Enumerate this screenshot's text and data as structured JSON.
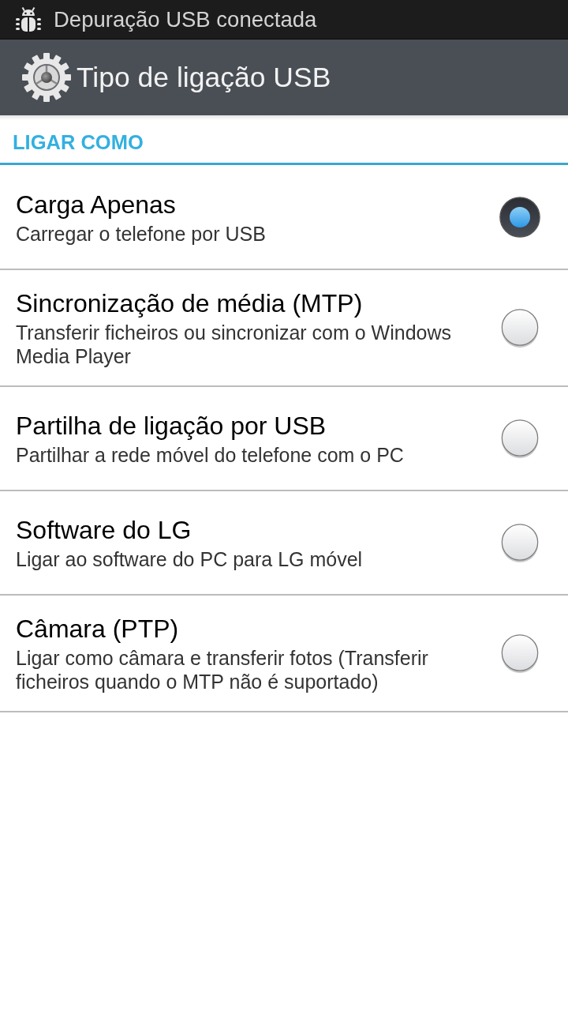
{
  "status_bar": {
    "notification": "Depuração USB conectada"
  },
  "header": {
    "title": "Tipo de ligação USB"
  },
  "section": {
    "title": "LIGAR COMO"
  },
  "options": [
    {
      "title": "Carga Apenas",
      "subtitle": "Carregar o telefone por USB",
      "selected": true
    },
    {
      "title": "Sincronização de média (MTP)",
      "subtitle": "Transferir ficheiros ou sincronizar com o Windows Media Player",
      "selected": false
    },
    {
      "title": "Partilha de ligação por USB",
      "subtitle": "Partilhar a rede móvel do telefone com o PC",
      "selected": false
    },
    {
      "title": "Software do LG",
      "subtitle": "Ligar ao software do PC para LG móvel",
      "selected": false
    },
    {
      "title": "Câmara (PTP)",
      "subtitle": "Ligar como câmara e transferir fotos (Transferir ficheiros quando o MTP não é suportado)",
      "selected": false
    }
  ]
}
